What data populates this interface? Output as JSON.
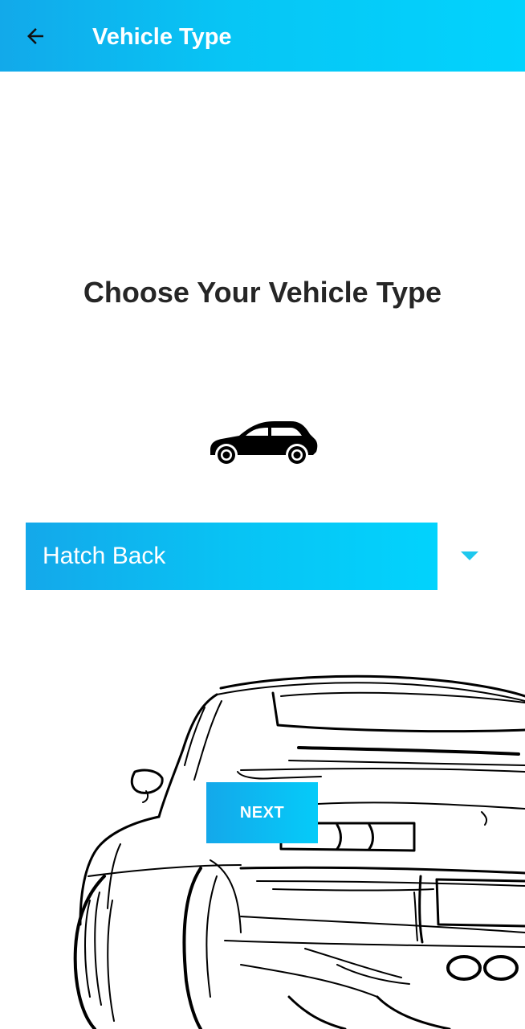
{
  "app_bar": {
    "title": "Vehicle Type",
    "back_icon": "arrow-left-icon",
    "gradient_start": "#12a9ea",
    "gradient_end": "#02d3fd"
  },
  "main": {
    "heading": "Choose Your Vehicle Type",
    "vehicle_icon": "hatchback-car-icon",
    "vehicle_select": {
      "selected_value": "Hatch Back",
      "arrow_icon": "caret-down-icon",
      "arrow_color": "#1ec8ee"
    },
    "next_button_label": "NEXT",
    "background_illustration": "sports-car-rear-sketch"
  }
}
